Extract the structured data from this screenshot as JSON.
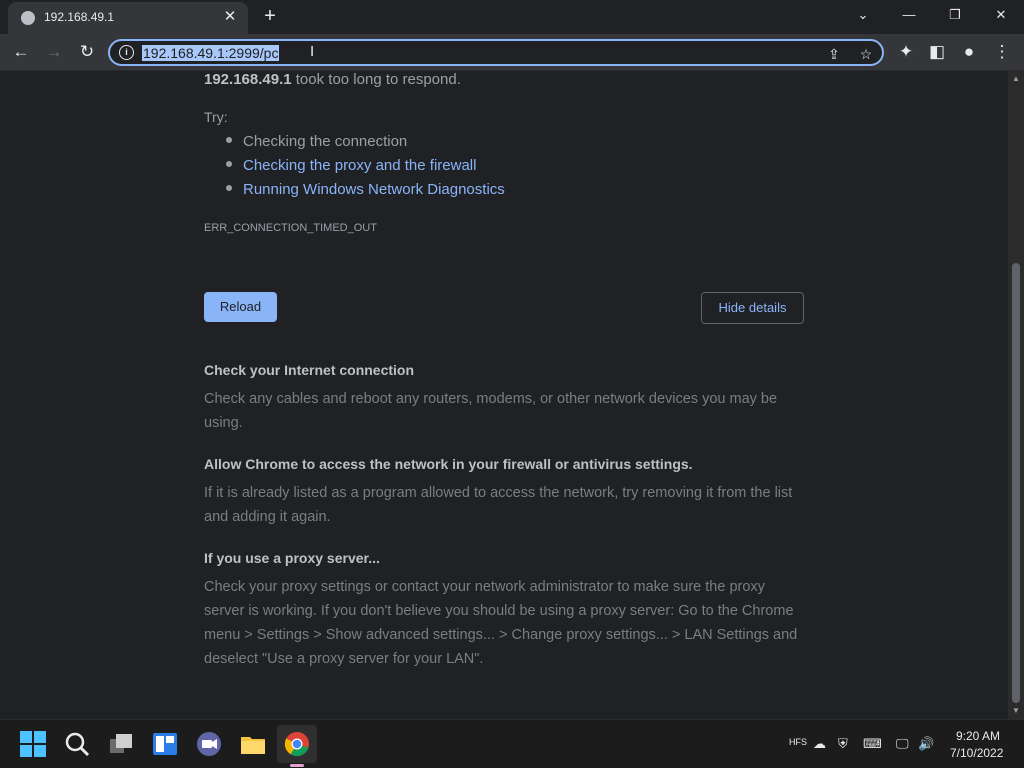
{
  "tab": {
    "title": "192.168.49.1",
    "close": "✕"
  },
  "newtab": "+",
  "window": {
    "minimize": "—",
    "restore": "❐",
    "close": "✕",
    "dropdown": "⌄"
  },
  "nav": {
    "back": "←",
    "forward": "→",
    "reload": "↻"
  },
  "omnibox": {
    "url": "192.168.49.1:2999/pc",
    "info": "i",
    "share": "⇪",
    "star": "☆"
  },
  "toolbar_right": {
    "extensions": "✦",
    "sidepanel": "◧",
    "profile": "●",
    "menu": "⋮"
  },
  "error": {
    "host": "192.168.49.1",
    "message": " took too long to respond.",
    "try_label": "Try:",
    "suggestions": [
      "Checking the connection",
      "Checking the proxy and the firewall",
      "Running Windows Network Diagnostics"
    ],
    "code": "ERR_CONNECTION_TIMED_OUT"
  },
  "buttons": {
    "reload": "Reload",
    "hide_details": "Hide details"
  },
  "details": [
    {
      "heading": "Check your Internet connection",
      "body": "Check any cables and reboot any routers, modems, or other network devices you may be using."
    },
    {
      "heading": "Allow Chrome to access the network in your firewall or antivirus settings.",
      "body": "If it is already listed as a program allowed to access the network, try removing it from the list and adding it again."
    },
    {
      "heading": "If you use a proxy server...",
      "body": "Check your proxy settings or contact your network administrator to make sure the proxy server is working. If you don't believe you should be using a proxy server: Go to the Chrome menu > Settings > Show advanced settings... > Change proxy settings... > LAN Settings and deselect \"Use a proxy server for your LAN\"."
    }
  ],
  "taskbar": {
    "tray_icons": [
      "HFS",
      "☁",
      "⛨",
      "⌨",
      "🖵",
      "🔊"
    ],
    "time": "9:20 AM",
    "date": "7/10/2022"
  }
}
